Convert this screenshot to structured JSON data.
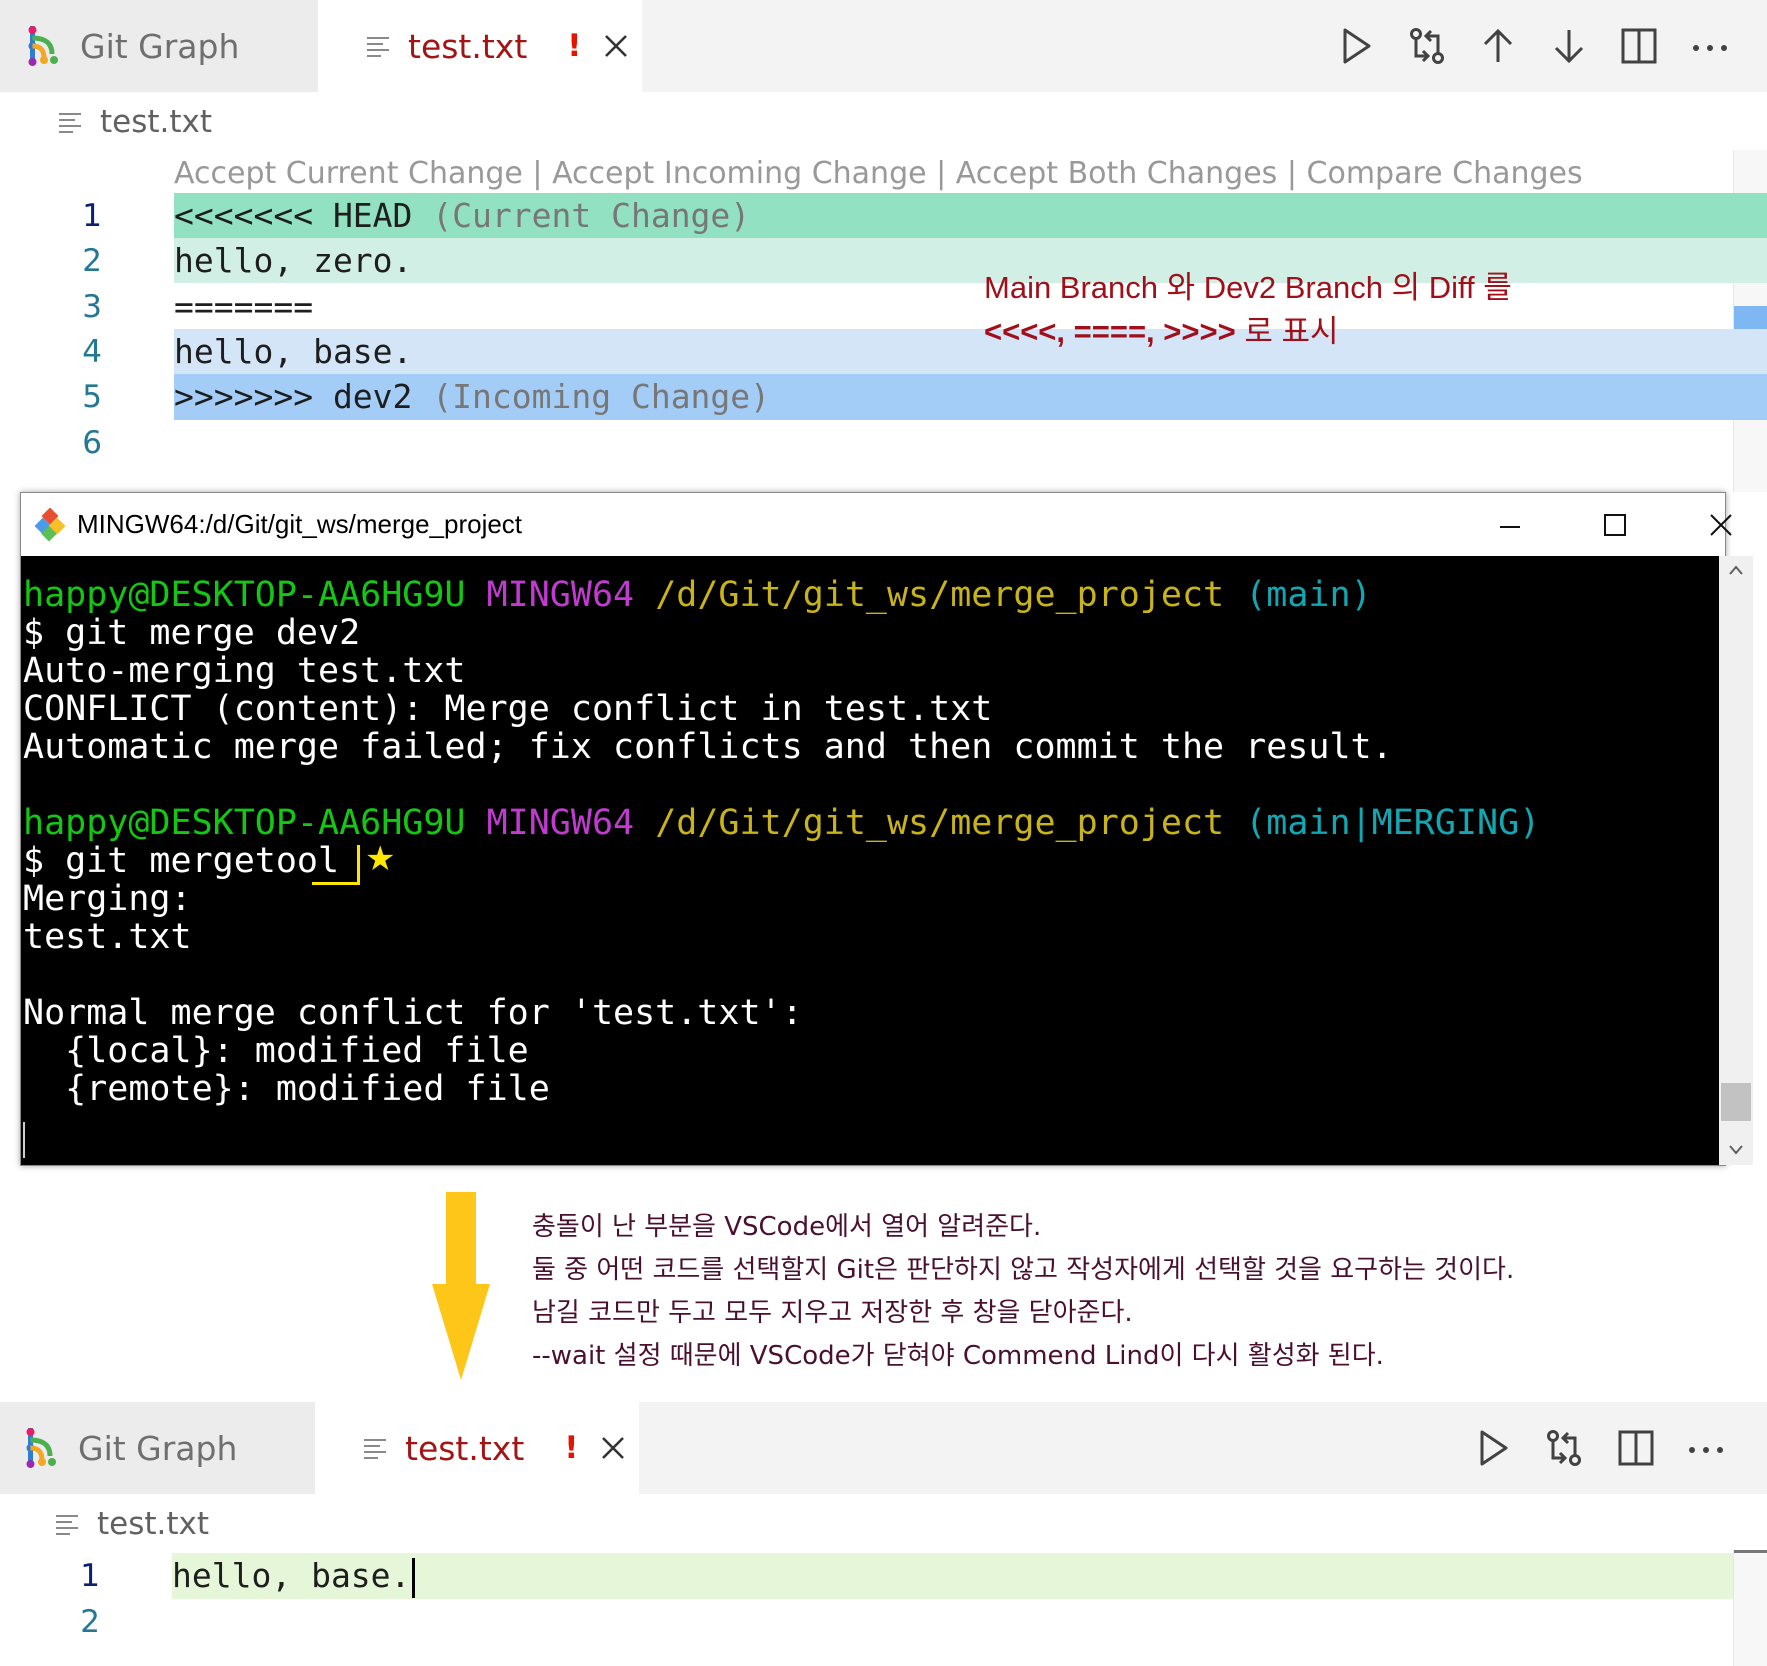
{
  "top_editor": {
    "tabs": {
      "git_graph": "Git Graph",
      "file": "test.txt",
      "warn": "!"
    },
    "breadcrumb": "test.txt",
    "codelens": [
      "Accept Current Change",
      "Accept Incoming Change",
      "Accept Both Changes",
      "Compare Changes"
    ],
    "codelens_sep": "|",
    "lines": [
      {
        "n": "1",
        "code": "<<<<<<< HEAD ",
        "muted": "(Current Change)"
      },
      {
        "n": "2",
        "code": "hello, zero.",
        "muted": ""
      },
      {
        "n": "3",
        "code": "=======",
        "muted": ""
      },
      {
        "n": "4",
        "code": "hello, base.",
        "muted": ""
      },
      {
        "n": "5",
        "code": ">>>>>>> dev2 ",
        "muted": "(Incoming Change)"
      },
      {
        "n": "6",
        "code": "",
        "muted": ""
      }
    ]
  },
  "annotation_red": {
    "line1": "Main Branch 와 Dev2 Branch 의 Diff 를",
    "line2_bold": "<<<<, ====, >>>>",
    "line2_rest": " 로 표시"
  },
  "terminal": {
    "title": "MINGW64:/d/Git/git_ws/merge_project",
    "prompt1": {
      "user": "happy@DESKTOP-AA6HG9U",
      "shell": "MINGW64",
      "path": "/d/Git/git_ws/merge_project",
      "branch": "(main)"
    },
    "cmd1": "$ git merge dev2",
    "out1": [
      "Auto-merging test.txt",
      "CONFLICT (content): Merge conflict in test.txt",
      "Automatic merge failed; fix conflicts and then commit the result."
    ],
    "prompt2": {
      "user": "happy@DESKTOP-AA6HG9U",
      "shell": "MINGW64",
      "path": "/d/Git/git_ws/merge_project",
      "branch": "(main|MERGING)"
    },
    "cmd2": "$ git mergetool",
    "star": "★",
    "out2": [
      "Merging:",
      "test.txt",
      "",
      "Normal merge conflict for 'test.txt':",
      "  {local}: modified file",
      "  {remote}: modified file"
    ]
  },
  "annotation_kr": [
    "충돌이 난 부분을 VSCode에서 열어 알려준다.",
    "둘 중 어떤 코드를 선택할지 Git은 판단하지 않고 작성자에게 선택할 것을 요구하는 것이다.",
    "남길 코드만 두고 모두 지우고 저장한 후 창을 닫아준다.",
    "--wait 설정 때문에 VSCode가 닫혀야 Commend Lind이 다시 활성화 된다."
  ],
  "bottom_editor": {
    "tabs": {
      "git_graph": "Git Graph",
      "file": "test.txt",
      "warn": "!"
    },
    "breadcrumb": "test.txt",
    "lines": [
      {
        "n": "1",
        "code": "hello, base."
      },
      {
        "n": "2",
        "code": ""
      }
    ]
  },
  "colors": {
    "current_header": "#93e1c3",
    "current_body": "#d2efe6",
    "incoming_body": "#d4e5f8",
    "incoming_header": "#a3cdf7",
    "arrow": "#ffc61a",
    "saved_line": "#e5f6d9"
  }
}
